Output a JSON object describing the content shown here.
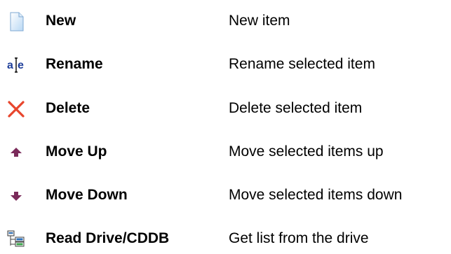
{
  "commands": [
    {
      "icon": "new-document-icon",
      "label": "New",
      "description": "New item"
    },
    {
      "icon": "rename-text-cursor-icon",
      "label": "Rename",
      "description": "Rename selected item"
    },
    {
      "icon": "delete-x-icon",
      "label": "Delete",
      "description": "Delete selected item"
    },
    {
      "icon": "arrow-up-icon",
      "label": "Move Up",
      "description": "Move selected items up"
    },
    {
      "icon": "arrow-down-icon",
      "label": "Move Down",
      "description": "Move selected items down"
    },
    {
      "icon": "drive-tree-icon",
      "label": "Read Drive/CDDB",
      "description": "Get list from the drive"
    }
  ],
  "icon_texts": {
    "rename_left": "a",
    "rename_right": "e"
  },
  "colors": {
    "delete_red": "#e8452c",
    "arrow_purple": "#7a2a5a",
    "rename_blue": "#1f3f9a",
    "document_blue": "#9cc6ee"
  }
}
